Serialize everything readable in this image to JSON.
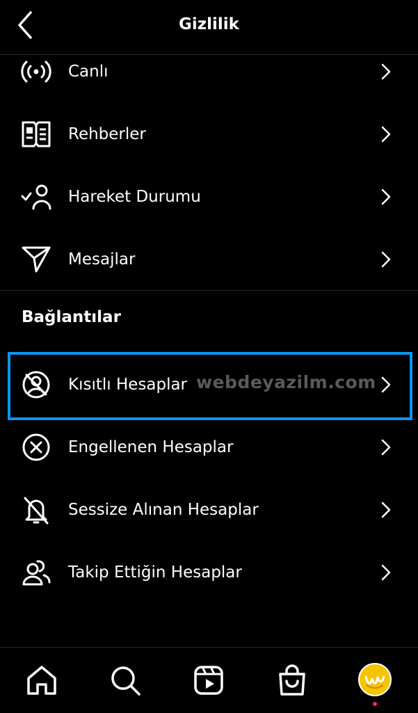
{
  "header": {
    "title": "Gizlilik"
  },
  "items_top": [
    {
      "label": "Canlı",
      "icon": "live-icon"
    },
    {
      "label": "Rehberler",
      "icon": "guides-icon"
    },
    {
      "label": "Hareket Durumu",
      "icon": "activity-status-icon"
    },
    {
      "label": "Mesajlar",
      "icon": "messages-icon"
    }
  ],
  "section": {
    "title": "Bağlantılar"
  },
  "items_connections": [
    {
      "label": "Kısıtlı Hesaplar",
      "icon": "restricted-icon",
      "highlighted": true
    },
    {
      "label": "Engellenen Hesaplar",
      "icon": "blocked-icon"
    },
    {
      "label": "Sessize Alınan Hesaplar",
      "icon": "muted-icon"
    },
    {
      "label": "Takip Ettiğin Hesaplar",
      "icon": "following-icon"
    }
  ],
  "watermark": "webdeyazilm.com",
  "nav": [
    "home-icon",
    "search-icon",
    "reels-icon",
    "shop-icon",
    "profile-avatar"
  ],
  "colors": {
    "background": "#000000",
    "text": "#ffffff",
    "highlight": "#0a95f0",
    "notification_dot": "#ff2a55",
    "avatar": "#f5c400"
  }
}
